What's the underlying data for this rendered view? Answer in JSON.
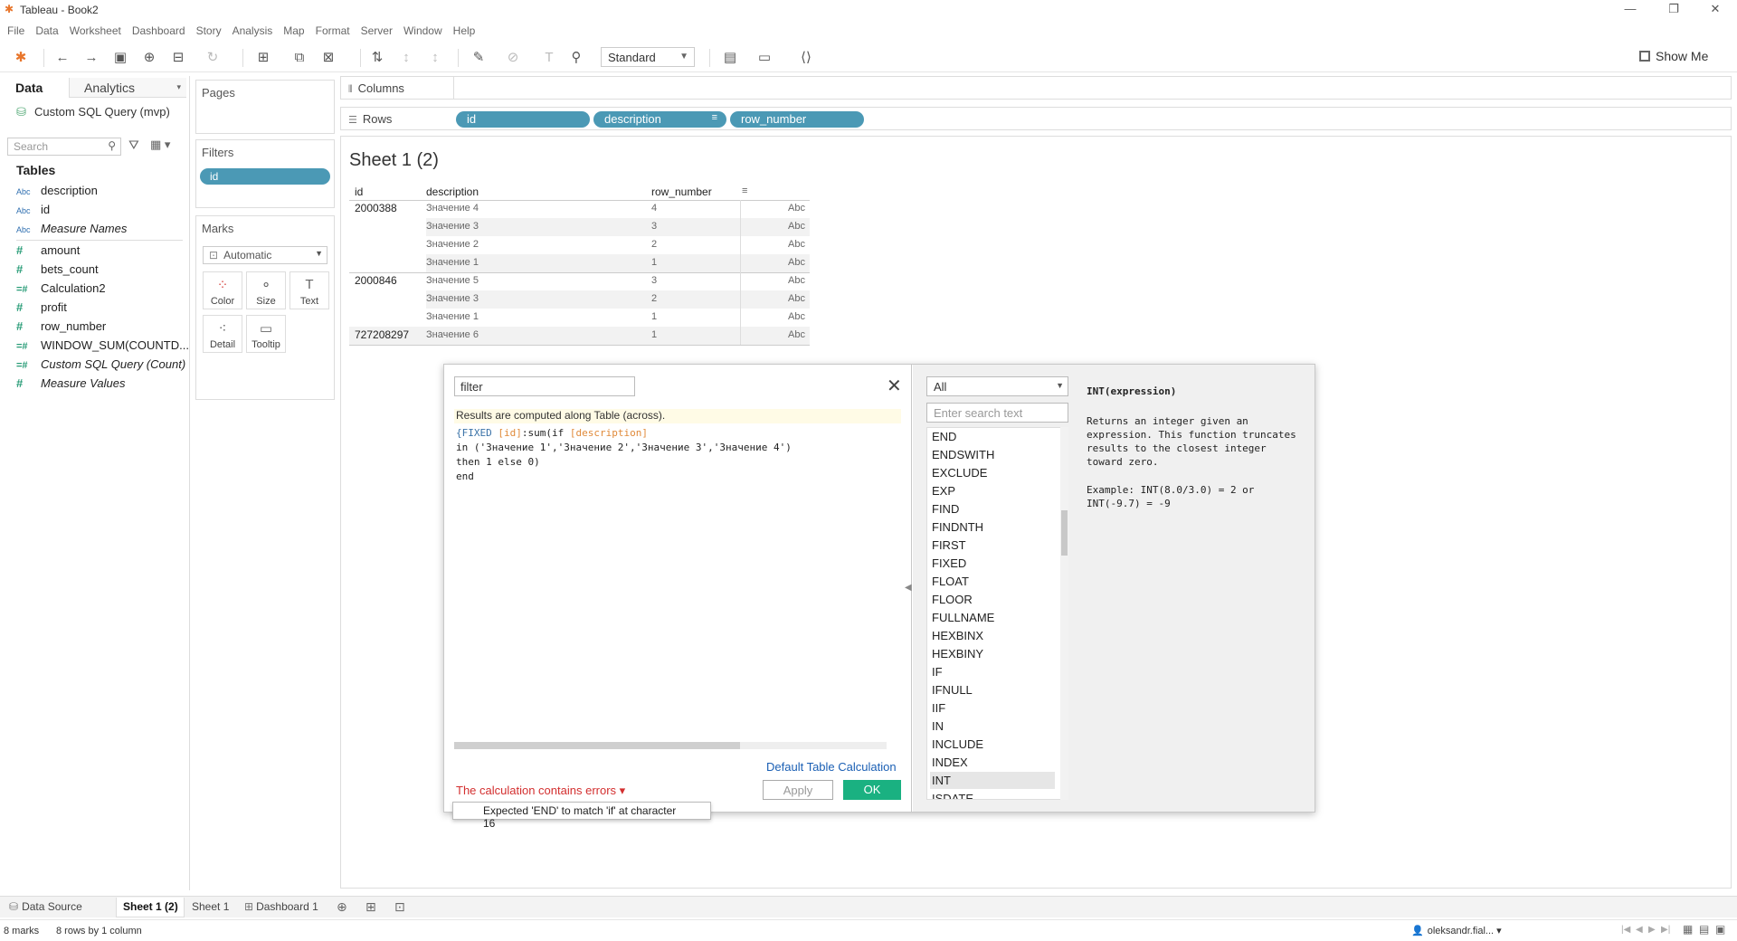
{
  "app": {
    "title": "Tableau - Book2"
  },
  "menu": [
    "File",
    "Data",
    "Worksheet",
    "Dashboard",
    "Story",
    "Analysis",
    "Map",
    "Format",
    "Server",
    "Window",
    "Help"
  ],
  "toolbar": {
    "fit_select": "Standard",
    "show_me": "Show Me"
  },
  "left": {
    "tab_data": "Data",
    "tab_analytics": "Analytics",
    "datasource": "Custom SQL Query (mvp)",
    "search_placeholder": "Search",
    "tables_heading": "Tables",
    "fields": [
      {
        "type": "Abc",
        "name": "description"
      },
      {
        "type": "Abc",
        "name": "id"
      },
      {
        "type": "Abc",
        "name": "Measure Names"
      },
      {
        "type": "#",
        "name": "amount"
      },
      {
        "type": "#",
        "name": "bets_count"
      },
      {
        "type": "=#",
        "name": "Calculation2"
      },
      {
        "type": "#",
        "name": "profit"
      },
      {
        "type": "#",
        "name": "row_number"
      },
      {
        "type": "=#",
        "name": "WINDOW_SUM(COUNTD..."
      },
      {
        "type": "=#",
        "name": "Custom SQL Query (Count)"
      },
      {
        "type": "#",
        "name": "Measure Values"
      }
    ]
  },
  "cards": {
    "pages": "Pages",
    "filters": "Filters",
    "filter_pill": "id",
    "marks": "Marks",
    "marks_type": "Automatic",
    "mark_buttons": [
      "Color",
      "Size",
      "Text",
      "Detail",
      "Tooltip"
    ]
  },
  "shelves": {
    "columns": "Columns",
    "rows": "Rows",
    "row_pills": [
      "id",
      "description",
      "row_number"
    ]
  },
  "view": {
    "sheet_title": "Sheet 1 (2)",
    "headers": [
      "id",
      "description",
      "row_number"
    ],
    "rows": [
      {
        "id": "2000388",
        "desc": "Значение 4",
        "rn": "4",
        "val": "Abc"
      },
      {
        "id": "",
        "desc": "Значение 3",
        "rn": "3",
        "val": "Abc"
      },
      {
        "id": "",
        "desc": "Значение 2",
        "rn": "2",
        "val": "Abc"
      },
      {
        "id": "",
        "desc": "Значение 1",
        "rn": "1",
        "val": "Abc"
      },
      {
        "id": "2000846",
        "desc": "Значение 5",
        "rn": "3",
        "val": "Abc"
      },
      {
        "id": "",
        "desc": "Значение 3",
        "rn": "2",
        "val": "Abc"
      },
      {
        "id": "",
        "desc": "Значение 1",
        "rn": "1",
        "val": "Abc"
      },
      {
        "id": "727208297",
        "desc": "Значение 6",
        "rn": "1",
        "val": "Abc"
      }
    ]
  },
  "dialog": {
    "calc_name": "filter",
    "note": "Results are computed along Table (across).",
    "code": {
      "l1_a": "{FIXED ",
      "l1_b": "[id]",
      "l1_c": ":sum(if ",
      "l1_d": "[description]",
      "l2": "in ('Значение 1','Значение 2','Значение 3','Значение 4')",
      "l3": "then 1 else 0)",
      "l4": "end"
    },
    "default_table_calc": "Default Table Calculation",
    "error": "The calculation contains errors",
    "error_tip": "Expected 'END' to match 'if' at character 16",
    "apply": "Apply",
    "ok": "OK"
  },
  "functions": {
    "category": "All",
    "search_placeholder": "Enter search text",
    "items": [
      "END",
      "ENDSWITH",
      "EXCLUDE",
      "EXP",
      "FIND",
      "FINDNTH",
      "FIRST",
      "FIXED",
      "FLOAT",
      "FLOOR",
      "FULLNAME",
      "HEXBINX",
      "HEXBINY",
      "IF",
      "IFNULL",
      "IIF",
      "IN",
      "INCLUDE",
      "INDEX",
      "INT",
      "ISDATE"
    ],
    "selected": "INT",
    "signature": "INT(expression)",
    "description": "Returns an integer given an expression. This function truncates results to the closest integer toward zero.",
    "example": "Example: INT(8.0/3.0) = 2 or INT(-9.7) = -9"
  },
  "tabs": {
    "data_source": "Data Source",
    "sheets": [
      "Sheet 1 (2)",
      "Sheet 1",
      "Dashboard 1"
    ]
  },
  "status": {
    "marks": "8 marks",
    "dims": "8 rows by 1 column",
    "user": "oleksandr.fial..."
  }
}
